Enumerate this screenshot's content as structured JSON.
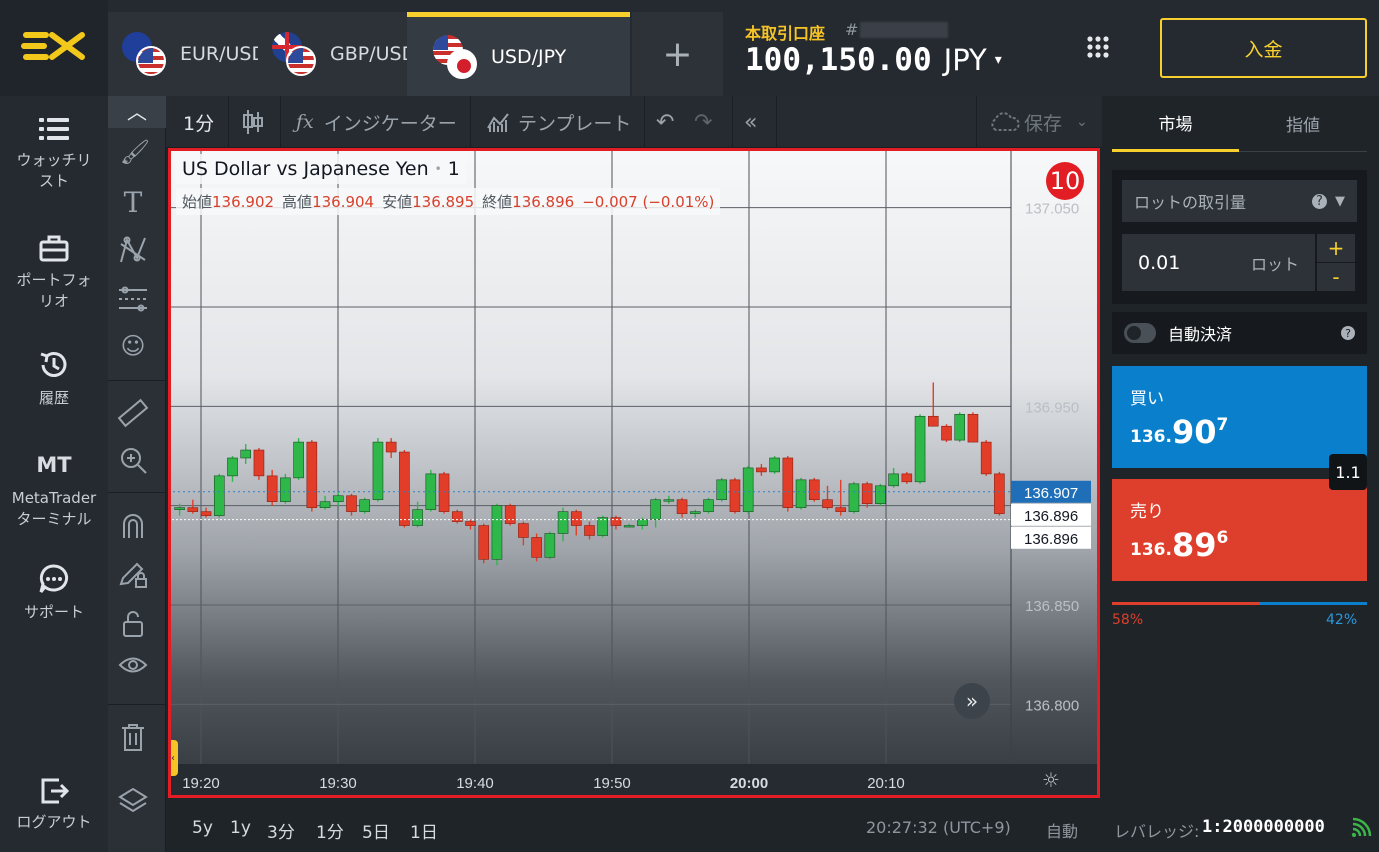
{
  "header": {
    "tabs": [
      {
        "label": "EUR/USD",
        "flags": [
          "eu",
          "us"
        ],
        "active": false
      },
      {
        "label": "GBP/USD",
        "flags": [
          "gb",
          "us"
        ],
        "active": false
      },
      {
        "label": "USD/JPY",
        "flags": [
          "us",
          "jp"
        ],
        "active": true
      }
    ],
    "add_tab": "+",
    "account_label": "本取引口座",
    "account_hash": "#",
    "balance": "100,150.00",
    "currency": "JPY",
    "deposit_button": "入金",
    "colors": {
      "accent": "#f7d02e",
      "buy": "#0a80cc",
      "sell": "#de3f2c"
    }
  },
  "nav": {
    "items": [
      {
        "label": "ウォッチリスト",
        "icon": "watchlist-icon"
      },
      {
        "label": "ポートフォリオ",
        "icon": "portfolio-icon"
      },
      {
        "label": "履歴",
        "icon": "history-icon"
      },
      {
        "label": "MetaTraderターミナル",
        "icon": "mt-icon",
        "icon_text": "MT"
      },
      {
        "label": "サポート",
        "icon": "support-icon"
      }
    ],
    "logout": "ログアウト"
  },
  "toolbar": {
    "interval": "1分",
    "indicators": "インジケーター",
    "templates": "テンプレート",
    "save": "保存"
  },
  "chart": {
    "title": "US Dollar vs Japanese Yen",
    "interval": "1",
    "ohlc": {
      "open_label": "始値",
      "open": "136.902",
      "high_label": "高値",
      "high": "136.904",
      "low_label": "安値",
      "low": "136.895",
      "close_label": "終値",
      "close": "136.896",
      "change": "−0.007 (−0.01%)"
    },
    "marker": "10",
    "price_axis": [
      "137.050",
      "136.950",
      "136.850",
      "136.800"
    ],
    "price_tags": {
      "ask": "136.907",
      "bid": "136.896",
      "last": "136.896"
    },
    "time_axis": [
      "19:20",
      "19:30",
      "19:40",
      "19:50",
      "20:00",
      "20:10"
    ]
  },
  "chart_data": {
    "type": "candlestick",
    "title": "US Dollar vs Japanese Yen",
    "x": [
      "19:20",
      "19:30",
      "19:40",
      "19:50",
      "20:00",
      "20:10"
    ],
    "ylim": [
      136.77,
      137.08
    ],
    "y_ticks": [
      137.05,
      136.95,
      136.85,
      136.8
    ],
    "candles": [
      [
        136.898,
        136.901,
        136.895,
        136.899
      ],
      [
        136.899,
        136.903,
        136.896,
        136.897
      ],
      [
        136.897,
        136.899,
        136.894,
        136.895
      ],
      [
        136.895,
        136.916,
        136.894,
        136.915
      ],
      [
        136.915,
        136.925,
        136.912,
        136.924
      ],
      [
        136.924,
        136.931,
        136.921,
        136.928
      ],
      [
        136.928,
        136.929,
        136.913,
        136.915
      ],
      [
        136.915,
        136.918,
        136.9,
        136.902
      ],
      [
        136.902,
        136.916,
        136.901,
        136.914
      ],
      [
        136.914,
        136.934,
        136.913,
        136.932
      ],
      [
        136.932,
        136.933,
        136.897,
        136.899
      ],
      [
        136.899,
        136.905,
        136.898,
        136.902
      ],
      [
        136.902,
        136.907,
        136.9,
        136.905
      ],
      [
        136.905,
        136.906,
        136.895,
        136.897
      ],
      [
        136.897,
        136.904,
        136.896,
        136.903
      ],
      [
        136.903,
        136.934,
        136.902,
        136.932
      ],
      [
        136.932,
        136.934,
        136.924,
        136.927
      ],
      [
        136.927,
        136.928,
        136.889,
        136.89
      ],
      [
        136.89,
        136.902,
        136.889,
        136.898
      ],
      [
        136.898,
        136.918,
        136.897,
        136.916
      ],
      [
        136.916,
        136.917,
        136.896,
        136.897
      ],
      [
        136.897,
        136.898,
        136.891,
        136.892
      ],
      [
        136.892,
        136.893,
        136.888,
        136.89
      ],
      [
        136.89,
        136.891,
        136.871,
        136.873
      ],
      [
        136.873,
        136.901,
        136.87,
        136.9
      ],
      [
        136.9,
        136.901,
        136.89,
        136.891
      ],
      [
        136.891,
        136.892,
        136.88,
        136.884
      ],
      [
        136.884,
        136.886,
        136.872,
        136.874
      ],
      [
        136.874,
        136.887,
        136.873,
        136.886
      ],
      [
        136.886,
        136.899,
        136.882,
        136.897
      ],
      [
        136.897,
        136.898,
        136.885,
        136.89
      ],
      [
        136.89,
        136.892,
        136.883,
        136.885
      ],
      [
        136.885,
        136.895,
        136.884,
        136.894
      ],
      [
        136.894,
        136.895,
        136.888,
        136.89
      ],
      [
        136.89,
        136.891,
        136.889,
        136.89
      ],
      [
        136.89,
        136.894,
        136.888,
        136.893
      ],
      [
        136.893,
        136.904,
        136.889,
        136.903
      ],
      [
        136.903,
        136.905,
        136.901,
        136.903
      ],
      [
        136.903,
        136.904,
        136.894,
        136.896
      ],
      [
        136.896,
        136.898,
        136.894,
        136.897
      ],
      [
        136.897,
        136.904,
        136.896,
        136.903
      ],
      [
        136.903,
        136.914,
        136.902,
        136.913
      ],
      [
        136.913,
        136.914,
        136.896,
        136.897
      ],
      [
        136.897,
        136.92,
        136.896,
        136.919
      ],
      [
        136.919,
        136.921,
        136.915,
        136.917
      ],
      [
        136.917,
        136.925,
        136.916,
        136.924
      ],
      [
        136.924,
        136.925,
        136.897,
        136.899
      ],
      [
        136.899,
        136.914,
        136.898,
        136.913
      ],
      [
        136.913,
        136.914,
        136.902,
        136.903
      ],
      [
        136.903,
        136.91,
        136.898,
        136.899
      ],
      [
        136.899,
        136.913,
        136.895,
        136.897
      ],
      [
        136.897,
        136.912,
        136.896,
        136.911
      ],
      [
        136.911,
        136.912,
        136.899,
        136.901
      ],
      [
        136.901,
        136.911,
        136.9,
        136.91
      ],
      [
        136.91,
        136.919,
        136.909,
        136.916
      ],
      [
        136.916,
        136.917,
        136.911,
        136.912
      ],
      [
        136.912,
        136.946,
        136.911,
        136.945
      ],
      [
        136.945,
        136.962,
        136.94,
        136.94
      ],
      [
        136.94,
        136.941,
        136.932,
        136.933
      ],
      [
        136.933,
        136.947,
        136.932,
        136.946
      ],
      [
        136.946,
        136.947,
        136.932,
        136.932
      ],
      [
        136.932,
        136.933,
        136.915,
        136.916
      ],
      [
        136.916,
        136.917,
        136.895,
        136.896
      ]
    ]
  },
  "bottom": {
    "ranges": [
      "5y",
      "1y",
      "3分",
      "1分",
      "5日",
      "1日"
    ],
    "clock": "20:27:32 (UTC+9)",
    "auto": "自動",
    "leverage_label": "レバレッジ:",
    "leverage": "1:2000000000"
  },
  "trade": {
    "tabs": [
      "市場",
      "指値"
    ],
    "lot_label": "ロットの取引量",
    "lot_value": "0.01",
    "lot_unit": "ロット",
    "auto_close": "自動決済",
    "buy_label": "買い",
    "buy_price_main": "136.",
    "buy_price_big": "90",
    "buy_price_small": "7",
    "sell_label": "売り",
    "sell_price_main": "136.",
    "sell_price_big": "89",
    "sell_price_small": "6",
    "spread": "1.1",
    "sell_pct": "58%",
    "buy_pct": "42%",
    "sell_ratio": 0.58
  }
}
